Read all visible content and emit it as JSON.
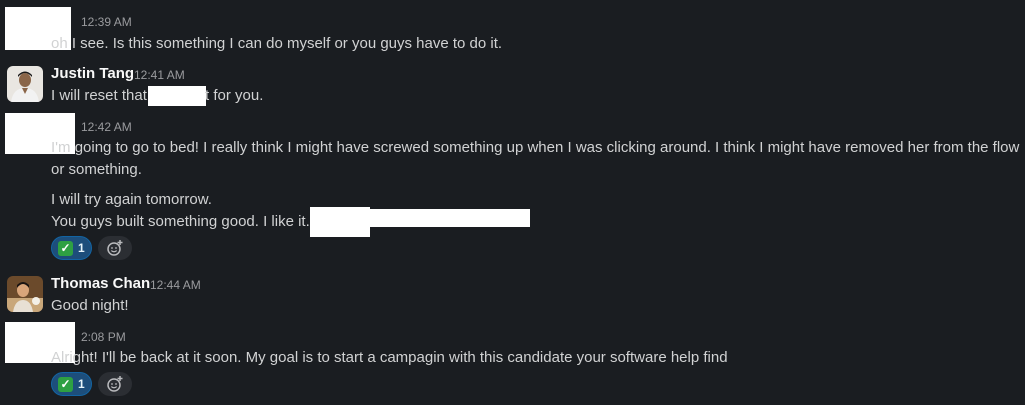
{
  "messages": [
    {
      "time": "12:39 AM",
      "lines": [
        "oh I see. Is this something I can do myself or you guys have to do it."
      ]
    },
    {
      "author": "Justin Tang",
      "time": "12:41 AM",
      "line_before": "I will reset that",
      "line_after": "t for you."
    },
    {
      "time": "12:42 AM",
      "lines": [
        "I'm going to go to bed! I really think I might have screwed something up when I was clicking around. I think I might have removed her from the flow",
        "or something.",
        "I will try again tomorrow.",
        "You guys built something good. I like it."
      ],
      "reaction": {
        "emoji": "✓",
        "count": "1"
      }
    },
    {
      "author": "Thomas Chan",
      "time": "12:44 AM",
      "lines": [
        "Good night!"
      ]
    },
    {
      "time": "2:08 PM",
      "lines": [
        "Alright! I'll be back at it soon. My goal is to start a campagin with this candidate your software help find"
      ],
      "reaction": {
        "emoji": "✓",
        "count": "1"
      }
    }
  ],
  "icons": {
    "reaction_emoji": "white-check-mark-icon",
    "add_reaction": "add-reaction-icon"
  },
  "colors": {
    "background": "#1a1d21",
    "text": "#d1d2d3",
    "timestamp": "#9a9b9e",
    "reaction_bg": "#1d4e7b",
    "reaction_border": "#1264a3"
  }
}
